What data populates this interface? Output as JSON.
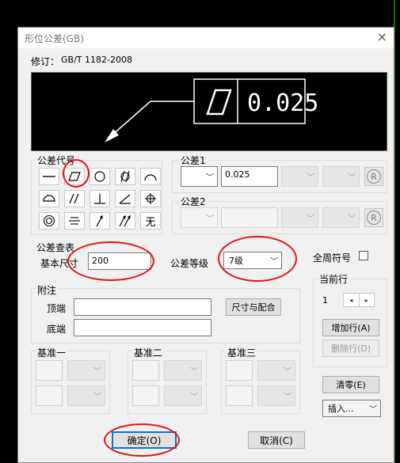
{
  "window": {
    "title": "形位公差(GB)",
    "close": "×"
  },
  "revision": {
    "label": "修订：",
    "value": "GB/T 1182-2008"
  },
  "preview": {
    "tolerance_text": "0.025"
  },
  "symbol_group": {
    "title": "公差代号"
  },
  "tolerance1": {
    "title": "公差1",
    "value": "0.025",
    "r_symbol": "R"
  },
  "tolerance2": {
    "title": "公差2",
    "r_symbol": "R"
  },
  "lookup": {
    "title": "公差查表",
    "size_label": "基本尺寸",
    "size_value": "200",
    "grade_label": "公差等级",
    "grade_value": "7级"
  },
  "all_around": {
    "label": "全周符号"
  },
  "notes": {
    "title": "附注",
    "top_label": "顶端",
    "bottom_label": "底端",
    "fit_button": "尺寸与配合"
  },
  "current_row": {
    "title": "当前行",
    "value": "1",
    "left": "◂",
    "right": "▸"
  },
  "row_buttons": {
    "add": "增加行(A)",
    "delete": "删除行(D)"
  },
  "datum": {
    "one": "基准一",
    "two": "基准二",
    "three": "基准三"
  },
  "side_buttons": {
    "clear": "清零(E)",
    "insert": "插入..."
  },
  "footer": {
    "ok": "确定(O)",
    "cancel": "取消(C)"
  },
  "colors": {
    "annotation_red": "#e01515",
    "preview_bg": "#000000",
    "dialog_bg": "#f0f0f0"
  }
}
